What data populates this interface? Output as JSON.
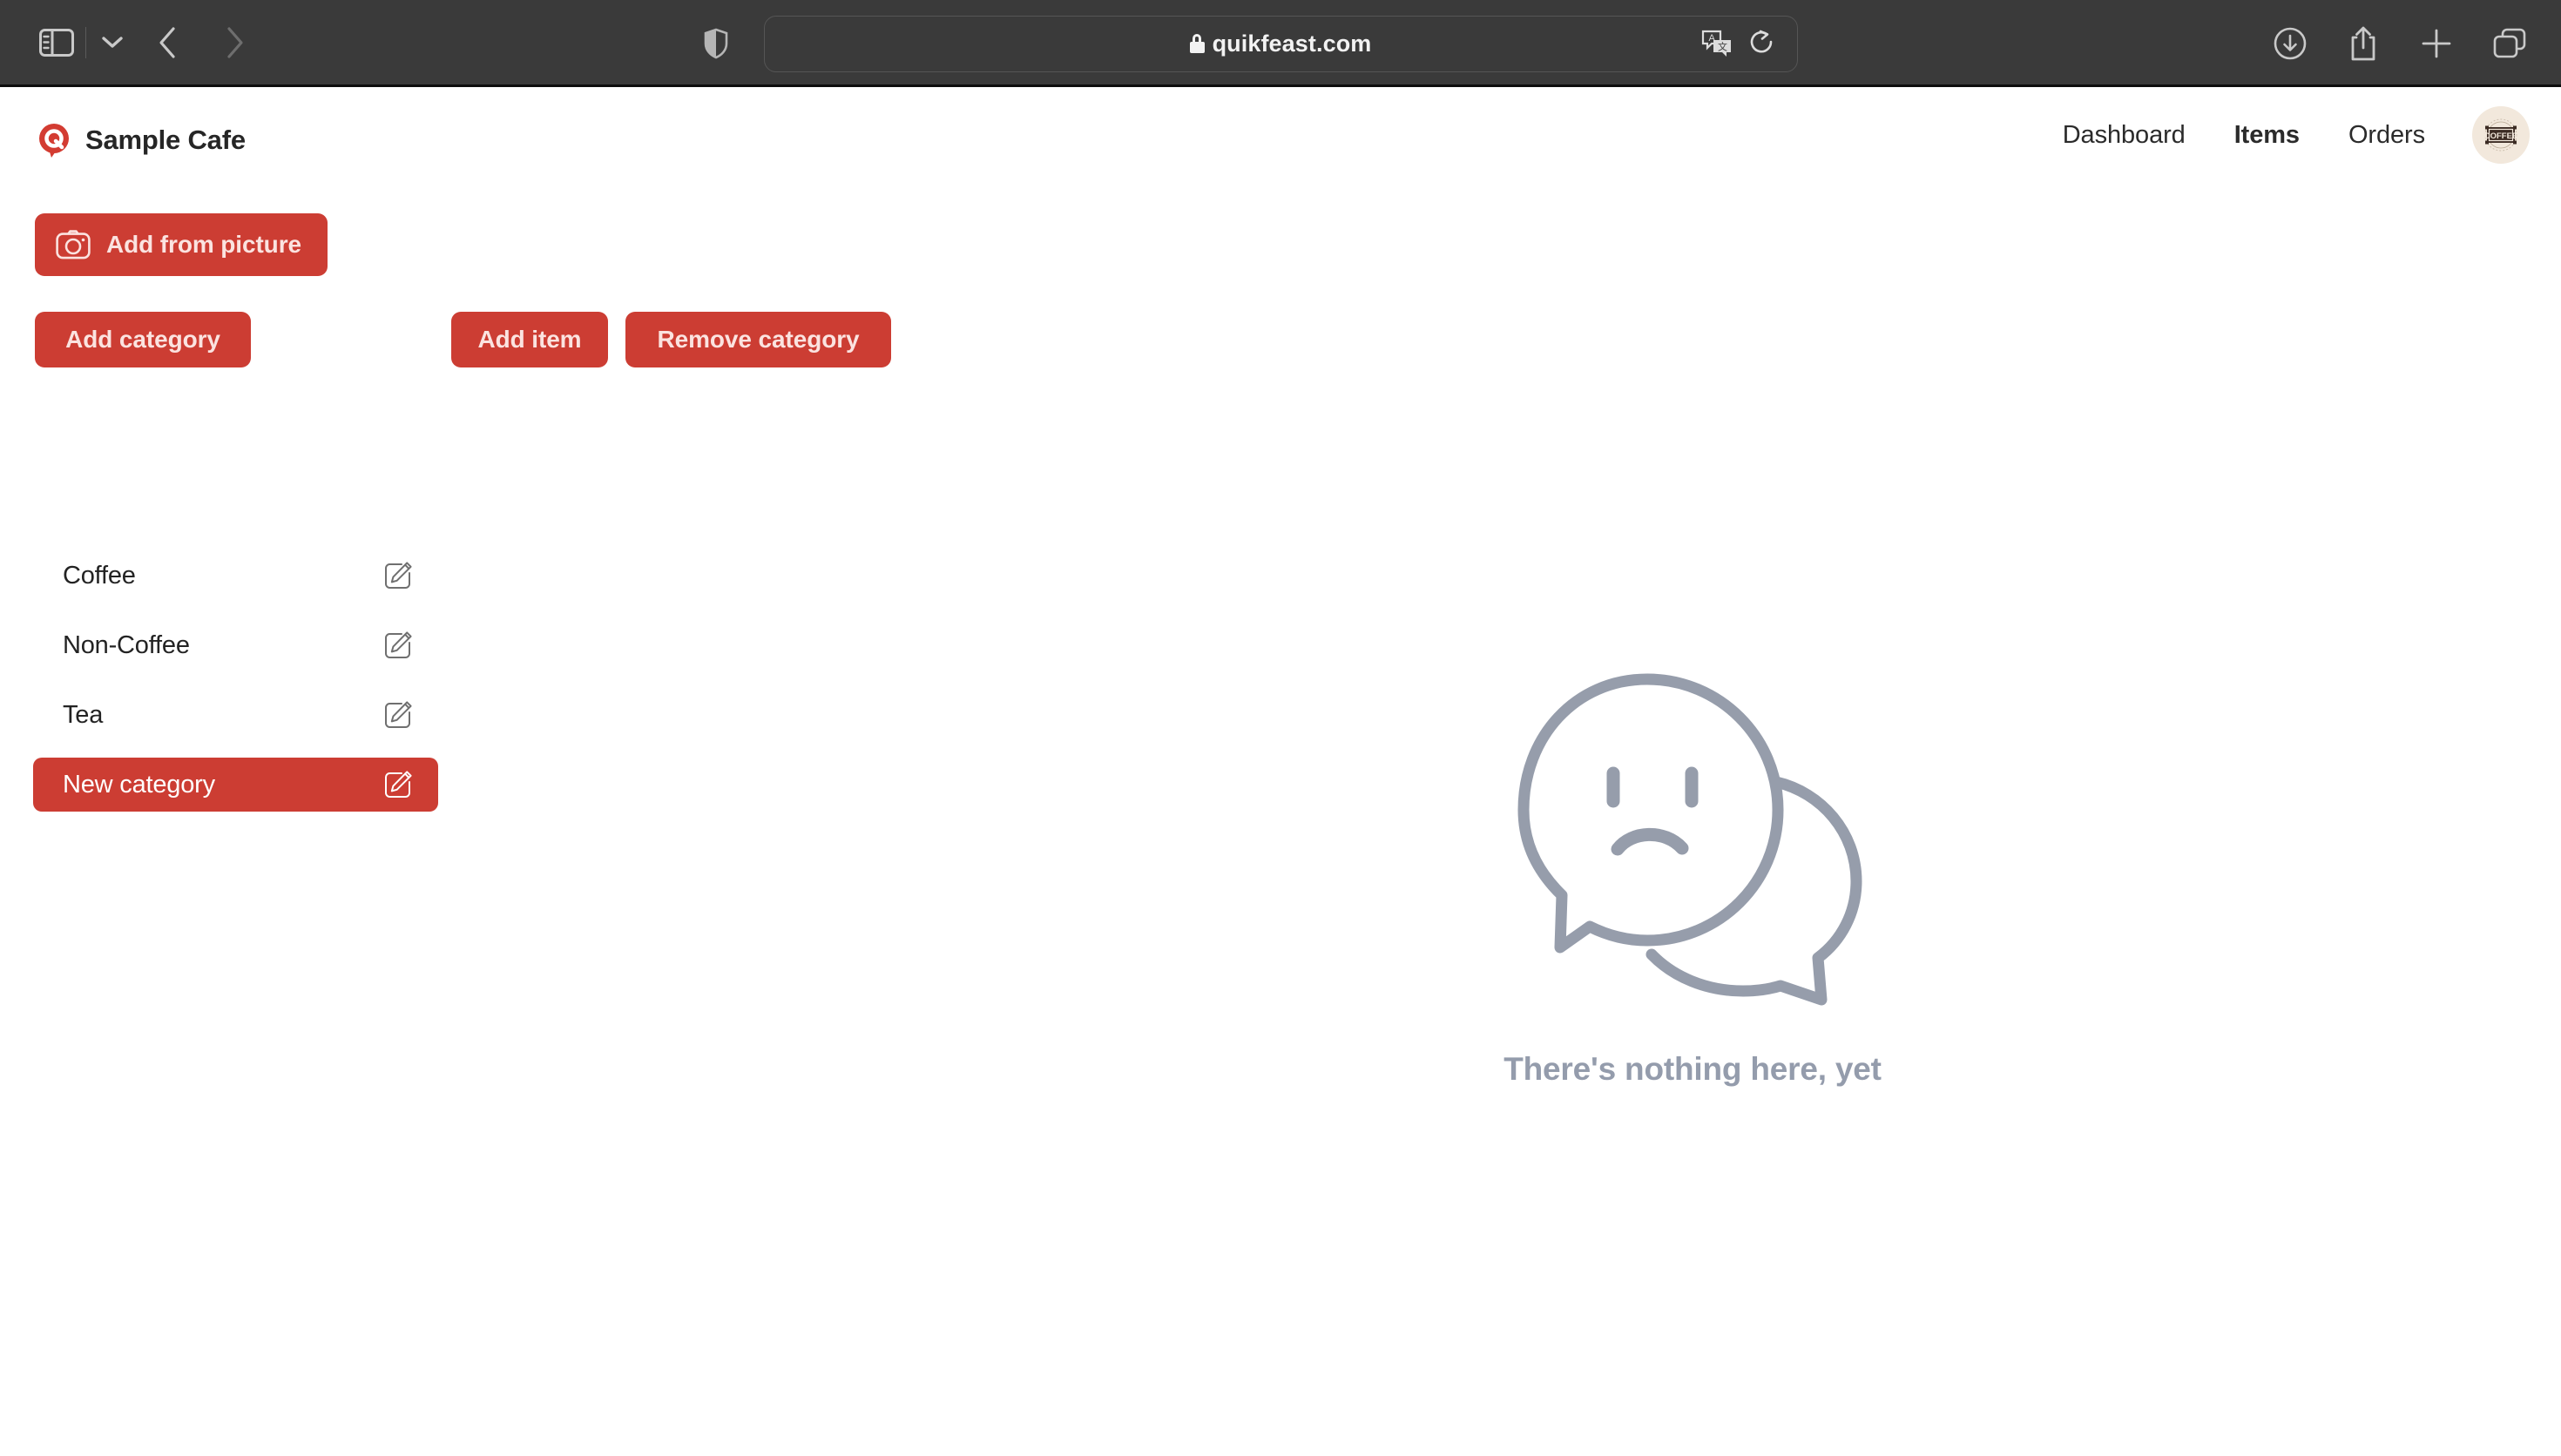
{
  "browser": {
    "url": "quikfeast.com",
    "secure_icon": "lock-icon",
    "toolbar_icons": {
      "sidebar": "sidebar-toggle-icon",
      "tab_group_chevron": "chevron-down-icon",
      "back": "back-arrow-icon",
      "forward": "forward-arrow-icon",
      "privacy_shield": "shield-icon",
      "translate": "translate-icon",
      "reload": "reload-icon",
      "downloads": "download-icon",
      "share": "share-icon",
      "new_tab": "plus-icon",
      "tab_overview": "tab-overview-icon"
    }
  },
  "header": {
    "brand_name": "Sample Cafe",
    "logo_icon": "quikfeast-q-logo",
    "nav": [
      {
        "label": "Dashboard",
        "active": false
      },
      {
        "label": "Items",
        "active": true
      },
      {
        "label": "Orders",
        "active": false
      }
    ],
    "avatar": {
      "label": "COFFEE",
      "icon": "coffee-badge-avatar"
    }
  },
  "toolbar": {
    "add_from_picture": "Add from picture",
    "camera_icon": "camera-icon",
    "add_category": "Add category",
    "add_item": "Add item",
    "remove_category": "Remove category"
  },
  "categories": [
    {
      "name": "Coffee",
      "selected": false
    },
    {
      "name": "Non-Coffee",
      "selected": false
    },
    {
      "name": "Tea",
      "selected": false
    },
    {
      "name": "New category",
      "selected": true
    }
  ],
  "empty_state": {
    "message": "There's nothing here, yet",
    "illustration": "sad-speech-bubbles-icon"
  },
  "colors": {
    "brand_red": "#cc3d33",
    "button_text": "#fbe3e0",
    "empty_grey": "#949cac",
    "chrome_bg": "#3a3a3a",
    "avatar_bg": "#f2e8dc"
  }
}
